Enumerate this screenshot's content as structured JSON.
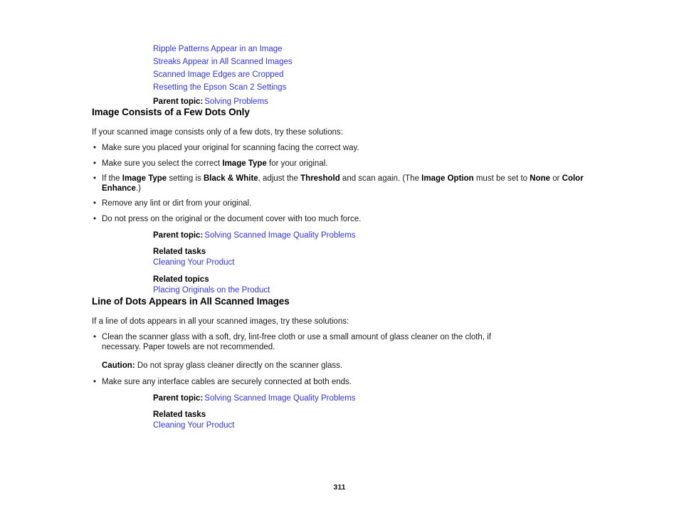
{
  "document": {
    "page_number": "311",
    "link_color": "#3333ee",
    "text_color": "#1a1a1a"
  },
  "top_links": {
    "items": [
      "Ripple Patterns Appear in an Image",
      "Streaks Appear in All Scanned Images",
      "Scanned Image Edges are Cropped",
      "Resetting the Epson Scan 2 Settings"
    ],
    "parent_topic": {
      "label": "Parent topic:",
      "link": "Solving Problems"
    }
  },
  "sections": [
    {
      "heading": "Image Consists of a Few Dots Only",
      "intro": "If your scanned image consists only of a few dots, try these solutions:",
      "bullets": [
        {
          "parts": [
            {
              "text": "Make sure you placed your original for scanning facing the correct way.",
              "bold": false
            }
          ]
        },
        {
          "parts": [
            {
              "text": "Make sure you select the correct ",
              "bold": false
            },
            {
              "text": "Image Type",
              "bold": true
            },
            {
              "text": " for your original.",
              "bold": false
            }
          ]
        },
        {
          "parts": [
            {
              "text": "If the ",
              "bold": false
            },
            {
              "text": "Image Type",
              "bold": true
            },
            {
              "text": " setting is ",
              "bold": false
            },
            {
              "text": "Black & White",
              "bold": true
            },
            {
              "text": ", adjust the ",
              "bold": false
            },
            {
              "text": "Threshold",
              "bold": true
            },
            {
              "text": " and scan again. (The ",
              "bold": false
            },
            {
              "text": "Image Option",
              "bold": true
            },
            {
              "text": " must be set to ",
              "bold": false
            },
            {
              "text": "None",
              "bold": true
            },
            {
              "text": " or ",
              "bold": false
            },
            {
              "text": "Color Enhance",
              "bold": true
            },
            {
              "text": ".)",
              "bold": false
            }
          ]
        },
        {
          "parts": [
            {
              "text": "Remove any lint or dirt from your original.",
              "bold": false
            }
          ]
        },
        {
          "parts": [
            {
              "text": "Do not press on the original or the document cover with too much force.",
              "bold": false
            }
          ]
        }
      ],
      "caution": null,
      "parent_topic": {
        "label": "Parent topic:",
        "link": "Solving Scanned Image Quality Problems"
      },
      "related": [
        {
          "heading": "Related tasks",
          "links": [
            "Cleaning Your Product"
          ]
        },
        {
          "heading": "Related topics",
          "links": [
            "Placing Originals on the Product"
          ]
        }
      ]
    },
    {
      "heading": "Line of Dots Appears in All Scanned Images",
      "intro": "If a line of dots appears in all your scanned images, try these solutions:",
      "bullets": [
        {
          "parts": [
            {
              "text": "Clean the scanner glass with a soft, dry, lint-free cloth or use a small amount of glass cleaner on the cloth, if necessary. Paper towels are not recommended.",
              "bold": false
            }
          ]
        }
      ],
      "caution": {
        "label": "Caution:",
        "text": " Do not spray glass cleaner directly on the scanner glass."
      },
      "bullets_after_caution": [
        {
          "parts": [
            {
              "text": "Make sure any interface cables are securely connected at both ends.",
              "bold": false
            }
          ]
        }
      ],
      "parent_topic": {
        "label": "Parent topic:",
        "link": "Solving Scanned Image Quality Problems"
      },
      "related": [
        {
          "heading": "Related tasks",
          "links": [
            "Cleaning Your Product"
          ]
        }
      ]
    }
  ]
}
